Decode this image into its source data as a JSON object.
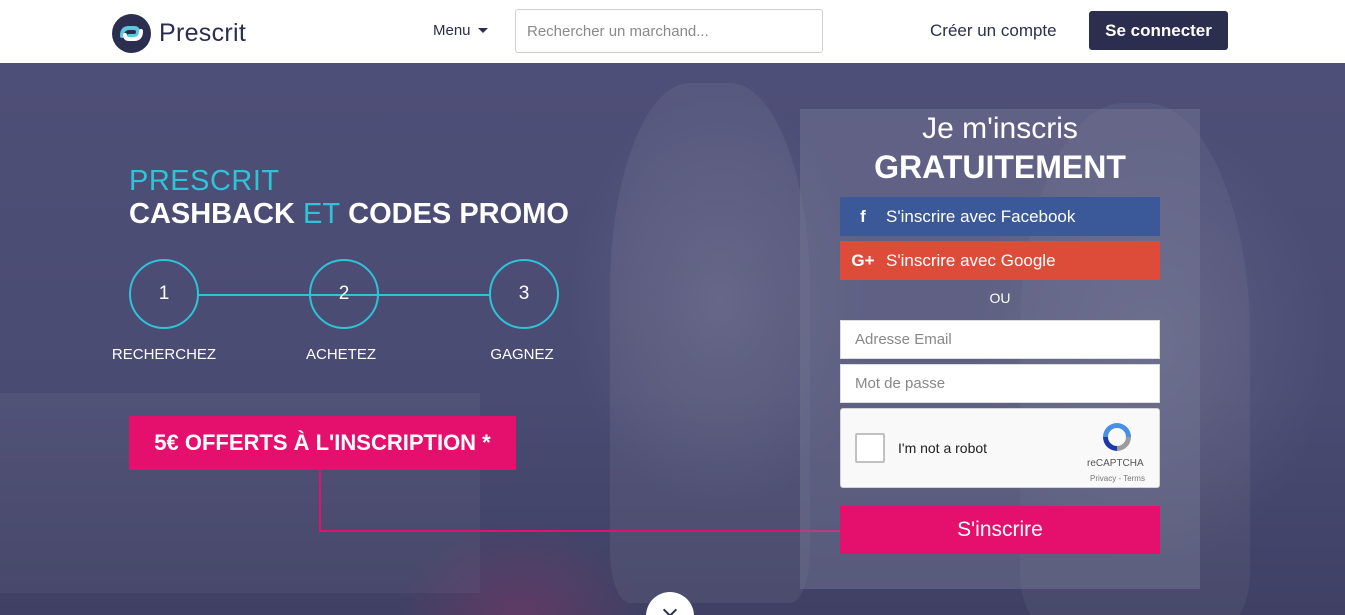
{
  "header": {
    "logo_text": "Prescrit",
    "menu_label": "Menu",
    "search_placeholder": "Rechercher un marchand...",
    "create_account": "Créer un compte",
    "login": "Se connecter"
  },
  "hero": {
    "brand": "PRESCRIT",
    "tagline_part1": "CASHBACK",
    "tagline_et": "ET",
    "tagline_part2": "CODES PROMO",
    "steps": [
      {
        "number": "1",
        "label": "RECHERCHEZ"
      },
      {
        "number": "2",
        "label": "ACHETEZ"
      },
      {
        "number": "3",
        "label": "GAGNEZ"
      }
    ],
    "promo": "5€ OFFERTS À L'INSCRIPTION *"
  },
  "signup": {
    "title_line1": "Je m'inscris",
    "title_line2": "GRATUITEMENT",
    "facebook_label": "S'inscrire avec Facebook",
    "google_label": "S'inscrire avec Google",
    "or_label": "OU",
    "email_placeholder": "Adresse Email",
    "password_placeholder": "Mot de passe",
    "captcha_label": "I'm not a robot",
    "captcha_brand": "reCAPTCHA",
    "captcha_terms": "Privacy - Terms",
    "submit_label": "S'inscrire"
  },
  "icons": {
    "facebook": "f",
    "google": "G+",
    "scroll": "chevron-down-icon"
  },
  "colors": {
    "navy": "#2b2e4f",
    "accent_pink": "#e5106d",
    "accent_teal": "#2ec3d6",
    "facebook": "#3b5998",
    "google": "#dd4b39"
  }
}
